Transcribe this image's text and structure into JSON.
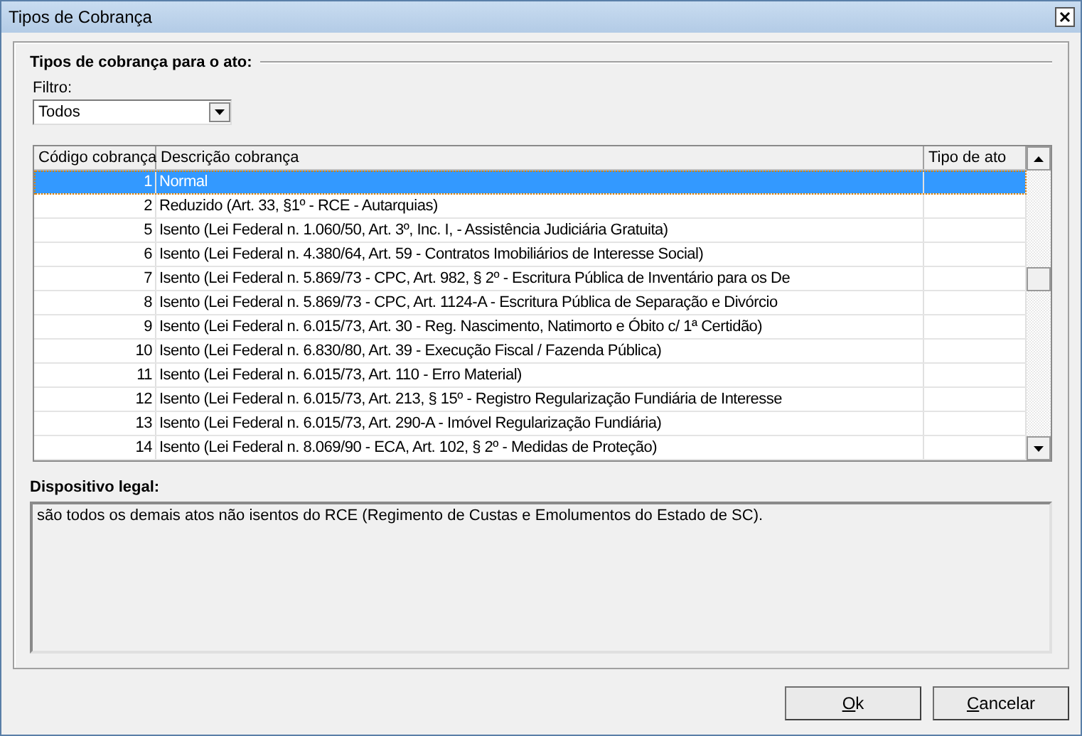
{
  "window": {
    "title": "Tipos de Cobrança"
  },
  "group": {
    "title": "Tipos de cobrança para o ato:"
  },
  "filter": {
    "label": "Filtro:",
    "value": "Todos"
  },
  "table": {
    "columns": [
      "Código cobrança",
      "Descrição cobrança",
      "Tipo de ato"
    ],
    "rows": [
      {
        "code": "1",
        "description": "Normal",
        "selected": true
      },
      {
        "code": "2",
        "description": "Reduzido (Art. 33, §1º - RCE - Autarquias)",
        "selected": false
      },
      {
        "code": "5",
        "description": "Isento (Lei Federal n. 1.060/50, Art. 3º, Inc. I, -  Assistência Judiciária Gratuita)",
        "selected": false
      },
      {
        "code": "6",
        "description": "Isento (Lei Federal n. 4.380/64, Art. 59 - Contratos Imobiliários de Interesse Social)",
        "selected": false
      },
      {
        "code": "7",
        "description": "Isento (Lei Federal n. 5.869/73 - CPC, Art. 982, § 2º - Escritura Pública de Inventário para os De",
        "selected": false
      },
      {
        "code": "8",
        "description": "Isento (Lei Federal n. 5.869/73 - CPC, Art. 1124-A - Escritura Pública de Separação e Divórcio",
        "selected": false
      },
      {
        "code": "9",
        "description": "Isento (Lei Federal n. 6.015/73, Art. 30 - Reg. Nascimento, Natimorto e Óbito c/ 1ª Certidão)",
        "selected": false
      },
      {
        "code": "10",
        "description": "Isento (Lei Federal n. 6.830/80, Art. 39 - Execução Fiscal / Fazenda Pública)",
        "selected": false
      },
      {
        "code": "11",
        "description": "Isento (Lei Federal n. 6.015/73, Art. 110 - Erro Material)",
        "selected": false
      },
      {
        "code": "12",
        "description": "Isento (Lei Federal n. 6.015/73, Art. 213, § 15º - Registro Regularização Fundiária de Interesse",
        "selected": false
      },
      {
        "code": "13",
        "description": "Isento (Lei Federal n. 6.015/73, Art. 290-A - Imóvel Regularização Fundiária)",
        "selected": false
      },
      {
        "code": "14",
        "description": "Isento (Lei Federal n. 8.069/90 - ECA, Art. 102, § 2º - Medidas de Proteção)",
        "selected": false
      }
    ]
  },
  "legal": {
    "label": "Dispositivo legal:",
    "text": "são todos os demais atos não isentos do RCE (Regimento de Custas e Emolumentos do Estado de SC)."
  },
  "buttons": [
    "Ok",
    "Cancelar"
  ]
}
